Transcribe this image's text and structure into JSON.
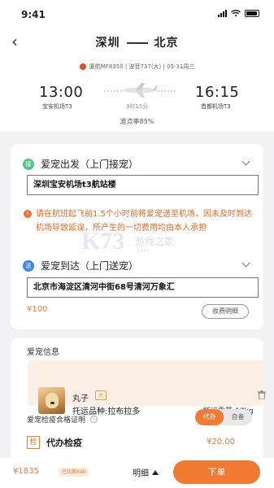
{
  "status_bar": {
    "time": "9:41"
  },
  "nav": {
    "from": "深圳",
    "to": "北京"
  },
  "flight": {
    "flight_no": "厦航MF8350",
    "aircraft": "波音737(大)",
    "date": "05-31周三",
    "dep_time": "13:00",
    "dep_airport": "宝安机场T3",
    "arr_time": "16:15",
    "arr_airport": "首都机场T3",
    "duration": "3时15分",
    "punctuality": "准点率85%"
  },
  "pickup": {
    "badge": "接",
    "title": "爱宠出发（上门接宠）",
    "address": "深圳宝安机场t3航站楼",
    "notice": "请在航班起飞前1.5个小时前将爱宠送至机场，因未及时到达机场导致延误，所产生的一切费用均由本人承担"
  },
  "delivery": {
    "badge": "送",
    "title": "爱宠到达（上门送宠）",
    "address": "北京市海淀区清河中街68号清河万象汇",
    "price": "¥100",
    "fee_detail_label": "收费明细"
  },
  "watermark": {
    "logo": "K73",
    "text": "游戏之家",
    "url": ".com"
  },
  "pet_info": {
    "title": "爱宠信息",
    "pet": {
      "name": "丸子",
      "size": "大",
      "breed": "托运品种:拉布拉多",
      "weight": "托运重量:13kg"
    },
    "cert_label": "爱宠检疫合格证明",
    "toggle": {
      "selected": "代办",
      "other": "自备"
    },
    "check": {
      "icon": "检",
      "label": "代办检疫",
      "price": "¥20.00"
    }
  },
  "bottom": {
    "total": "¥1835",
    "discount": "已优惠¥40",
    "detail_label": "明细",
    "order_label": "下单"
  },
  "colors": {
    "accent": "#f17a33",
    "green": "#55c38b",
    "blue": "#3d86e6"
  }
}
